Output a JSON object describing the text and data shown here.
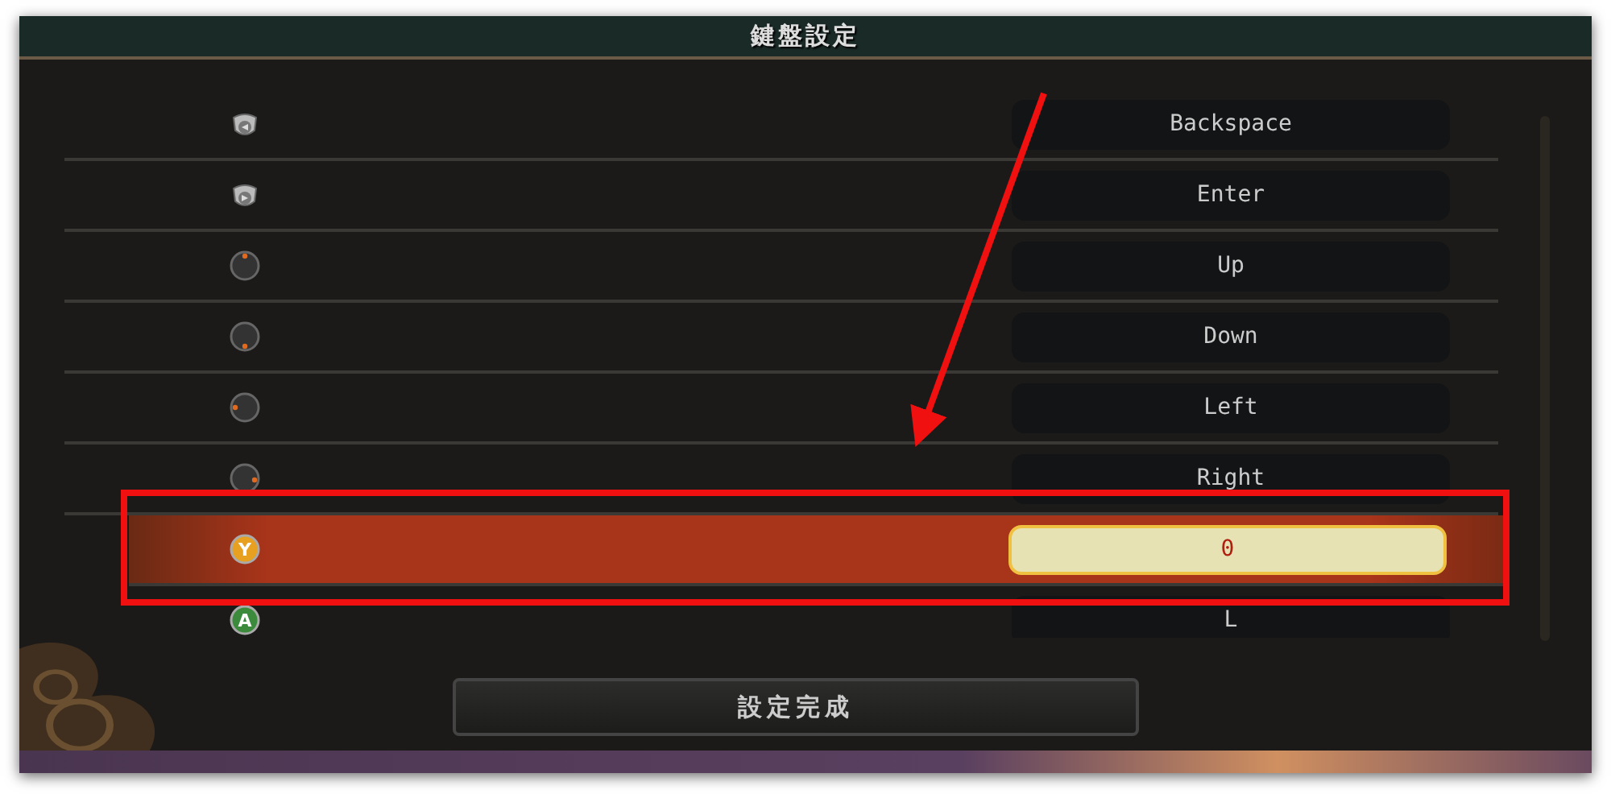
{
  "window": {
    "title": "鍵盤設定"
  },
  "bindings": [
    {
      "kind": "back",
      "key": "Backspace",
      "selected": false
    },
    {
      "kind": "start",
      "key": "Enter",
      "selected": false
    },
    {
      "kind": "up",
      "key": "Up",
      "selected": false
    },
    {
      "kind": "down",
      "key": "Down",
      "selected": false
    },
    {
      "kind": "left",
      "key": "Left",
      "selected": false
    },
    {
      "kind": "right",
      "key": "Right",
      "selected": false
    },
    {
      "kind": "face",
      "letter": "Y",
      "color": "#e8a020",
      "key": "0",
      "selected": true
    },
    {
      "kind": "face",
      "letter": "A",
      "color": "#3c8a3c",
      "key": "L",
      "selected": false
    }
  ],
  "done_button": "設定完成"
}
